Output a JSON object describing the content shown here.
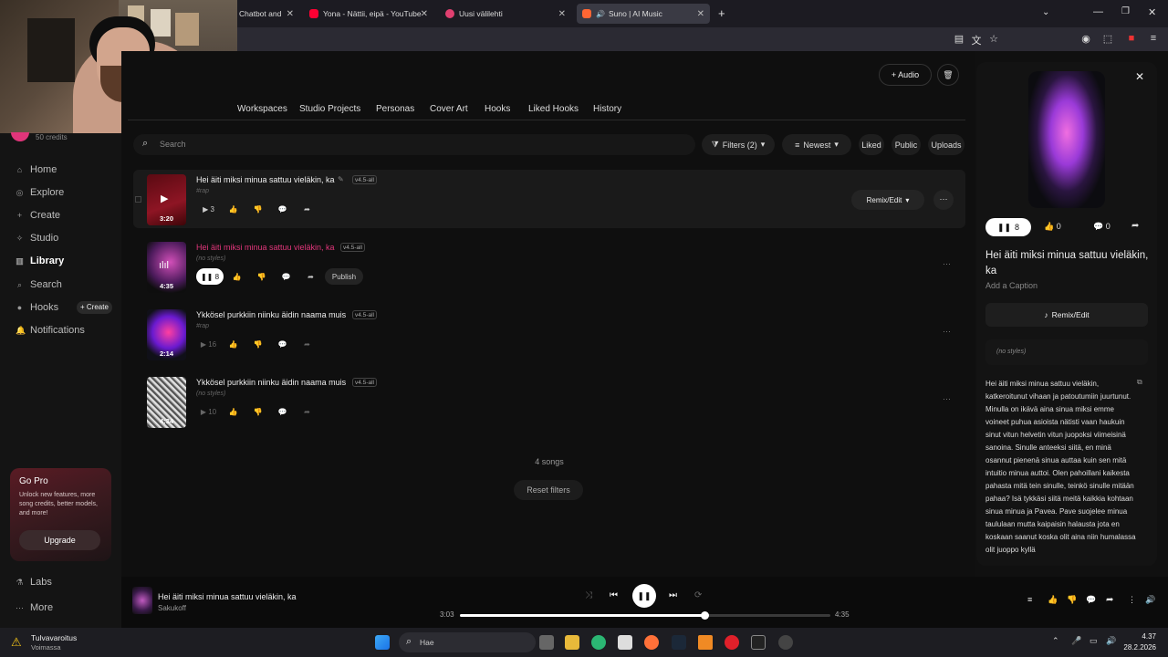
{
  "browser": {
    "tabs": [
      {
        "label": "Chatbot and",
        "color": "#888888"
      },
      {
        "label": "Yona - Nättii, eipä - YouTube",
        "color": "#ff0033"
      },
      {
        "label": "Uusi välilehti",
        "color": "#e04070"
      },
      {
        "label": "Suno | AI Music",
        "color": "#ff6633"
      }
    ],
    "new_tab": "+"
  },
  "sidebar": {
    "credits": "50 credits",
    "items": [
      {
        "label": "Home"
      },
      {
        "label": "Explore"
      },
      {
        "label": "Create"
      },
      {
        "label": "Studio"
      },
      {
        "label": "Library"
      },
      {
        "label": "Search"
      },
      {
        "label": "Hooks"
      },
      {
        "label": "Notifications"
      }
    ],
    "hooks_create": "+ Create",
    "gopro": {
      "title": "Go Pro",
      "text": "Unlock new features, more song credits, better models, and more!",
      "button": "Upgrade"
    },
    "labs": "Labs",
    "more": "More"
  },
  "header": {
    "audio_button": "+ Audio",
    "tabs": [
      "Workspaces",
      "Studio Projects",
      "Personas",
      "Cover Art",
      "Hooks",
      "Liked Hooks",
      "History"
    ]
  },
  "toolbar": {
    "search_placeholder": "Search",
    "filters": "Filters (2)",
    "sort": "Newest",
    "liked": "Liked",
    "public": "Public",
    "uploads": "Uploads"
  },
  "songs": [
    {
      "title": "Hei äiti miksi minua sattuu vieläkin, ka",
      "version": "v4.5-all",
      "style": "#rap",
      "duration": "3:20",
      "plays": "3",
      "remix": "Remix/Edit"
    },
    {
      "title": "Hei äiti miksi minua sattuu vieläkin, ka",
      "version": "v4.5-all",
      "style": "(no styles)",
      "duration": "4:35",
      "plays": "8",
      "publish": "Publish"
    },
    {
      "title": "Ykkösel purkkiin niinku äidin naama muis",
      "version": "v4.5-all",
      "style": "#rap",
      "duration": "2:14",
      "plays": "16"
    },
    {
      "title": "Ykkösel purkkiin niinku äidin naama muis",
      "version": "v4.5-all",
      "style": "(no styles)",
      "duration": "4:34",
      "plays": "10"
    }
  ],
  "list_footer": {
    "count": "4 songs",
    "reset": "Reset filters"
  },
  "detail": {
    "plays": "8",
    "likes": "0",
    "comments": "0",
    "title": "Hei äiti miksi minua sattuu vieläkin, ka",
    "caption": "Add a Caption",
    "remix": "Remix/Edit",
    "style": "(no styles)",
    "lyrics": "Hei äiti miksi minua sattuu vieläkin, katkeroitunut vihaan ja patoutumiin juurtunut. Minulla on ikävä aina sinua miksi emme voineet puhua asioista nätisti vaan haukuin sinut vitun helvetin vitun juopoksi viimeisinä sanoina. Sinulle anteeksi siitä, en minä osannut pienenä sinua auttaa kuin sen mitä intuitio minua auttoi. Olen pahoillani kaikesta pahasta mitä tein sinulle, teinkö sinulle mitään pahaa? Isä tykkäsi siitä meitä kaikkia kohtaan sinua minua ja Pavea. Pave suojelee minua taululaan mutta kaipaisin halausta jota en koskaan saanut koska olit aina niin humalassa olit juoppo kyllä"
  },
  "player": {
    "title": "Hei äiti miksi minua sattuu vieläkin, ka",
    "artist": "Sakukoff",
    "current": "3:03",
    "total": "4:35",
    "progress": 0.66
  },
  "taskbar": {
    "weather_title": "Tulvavaroitus",
    "weather_sub": "Voimassa",
    "search": "Hae",
    "time": "4.37",
    "date": "28.2.2026"
  },
  "colors": {
    "accent": "#e0357a",
    "brand": "#ff6633"
  }
}
